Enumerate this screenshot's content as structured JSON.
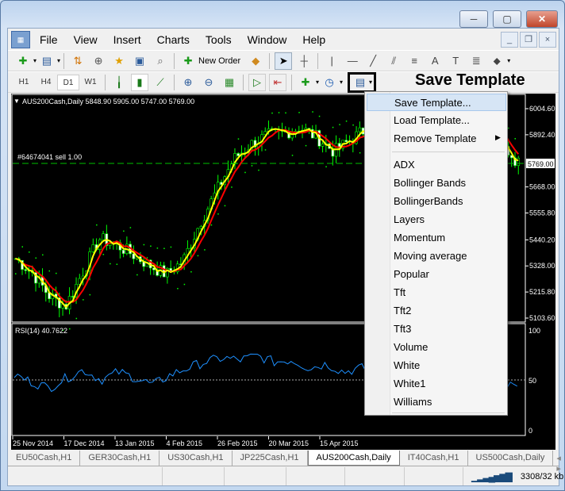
{
  "window": {
    "minimize": "─",
    "maximize": "▢",
    "close": "✕"
  },
  "menu": [
    "File",
    "View",
    "Insert",
    "Charts",
    "Tools",
    "Window",
    "Help"
  ],
  "toolbar": {
    "new_order": "New Order"
  },
  "timeframes": [
    "H1",
    "H4",
    "D1",
    "W1"
  ],
  "annotation": "Save Template",
  "chart": {
    "header": "AUS200Cash,Daily  5848.90 5905.00 5747.00 5769.00",
    "order_label": "#64674041 sell 1.00",
    "current_price": "5769.00",
    "price_ticks": [
      "6004.60",
      "5892.40",
      "5769.00",
      "5668.00",
      "5555.80",
      "5440.20",
      "5328.00",
      "5215.80",
      "5103.60"
    ],
    "rsi_label": "RSI(14) 40.7622",
    "rsi_ticks": [
      "100",
      "50",
      "0"
    ],
    "date_ticks": [
      "25 Nov 2014",
      "17 Dec 2014",
      "13 Jan 2015",
      "4 Feb 2015",
      "26 Feb 2015",
      "20 Mar 2015",
      "15 Apr 2015"
    ],
    "colors": {
      "bull": "#00ff00",
      "bear": "#ffffff",
      "ma_fast": "#ffff00",
      "ma_slow": "#ff0000",
      "sar": "#00ff00",
      "rsi": "#1e90ff",
      "order_line": "#00c000"
    }
  },
  "chart_data": {
    "type": "candlestick",
    "closes": [
      5360,
      5300,
      5200,
      5155,
      5300,
      5445,
      5420,
      5377,
      5330,
      5291,
      5350,
      5513,
      5650,
      5786,
      5850,
      5889,
      5900,
      5923,
      5880,
      5820,
      5870,
      5923,
      5880,
      5854,
      5900,
      5940,
      5900,
      5820,
      5957,
      5850,
      5769
    ],
    "ylim": [
      5103.6,
      6004.6
    ],
    "rsi": [
      55,
      48,
      42,
      52,
      60,
      50,
      58,
      52,
      45,
      55,
      62,
      68,
      72,
      70,
      74,
      68,
      70,
      62,
      66,
      58,
      62,
      55,
      60,
      52,
      58,
      48,
      54,
      44,
      50,
      40.76
    ],
    "rsi_ylim": [
      0,
      100
    ]
  },
  "context_menu": {
    "items": [
      "Save Template...",
      "Load Template...",
      "Remove Template"
    ],
    "templates": [
      "ADX",
      "Bollinger Bands",
      "BollingerBands",
      "Layers",
      "Momentum",
      "Moving average",
      "Popular",
      "Tft",
      "Tft2",
      "Tft3",
      "Volume",
      "White",
      "White1",
      "Williams"
    ]
  },
  "tabs": [
    "EU50Cash,H1",
    "GER30Cash,H1",
    "US30Cash,H1",
    "JP225Cash,H1",
    "AUS200Cash,Daily",
    "IT40Cash,H1",
    "US500Cash,Daily"
  ],
  "active_tab": "AUS200Cash,Daily",
  "status": {
    "traffic": "3308/32 kb"
  }
}
